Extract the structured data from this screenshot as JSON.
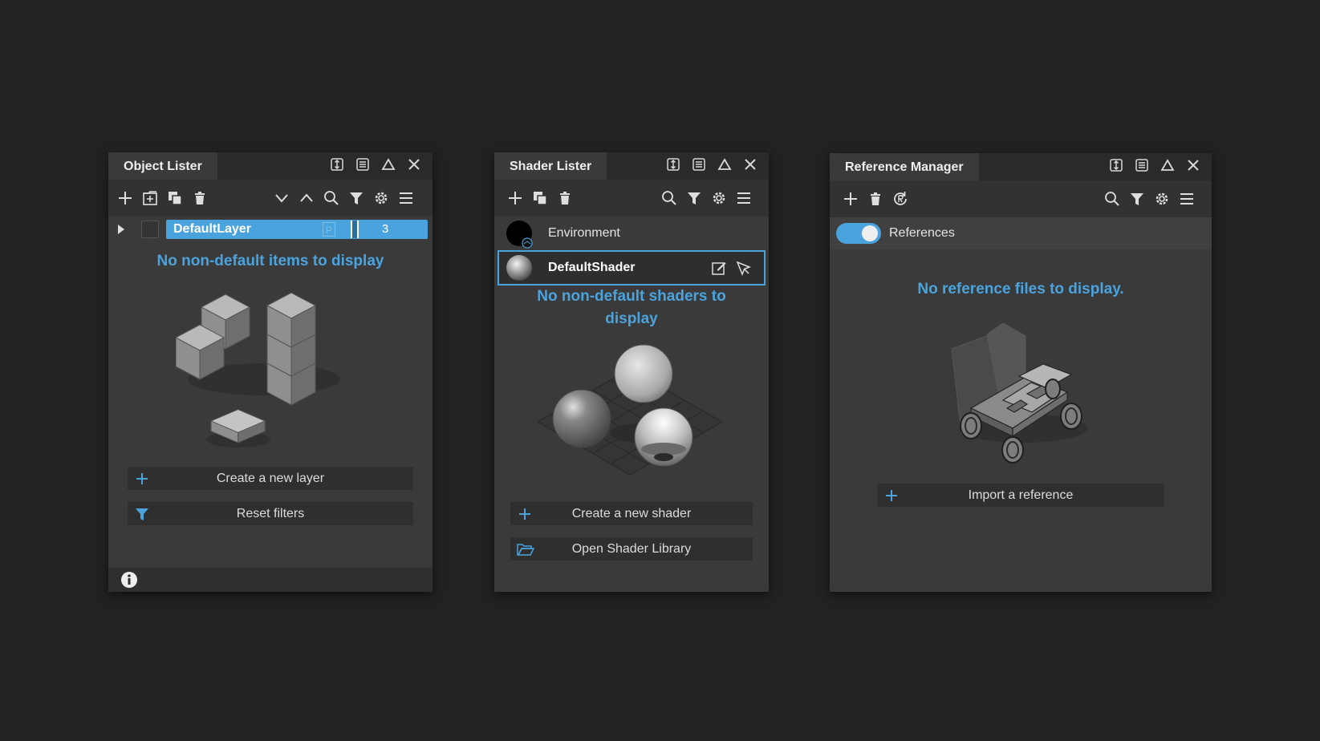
{
  "colors": {
    "accent": "#4ba3dd",
    "panel": "#3a3a3a",
    "background": "#222222"
  },
  "object_lister": {
    "title": "Object Lister",
    "layer": {
      "name": "DefaultLayer",
      "count": "3",
      "p_label": "P"
    },
    "empty_message": "No non-default items to display",
    "actions": {
      "create_layer": "Create a new layer",
      "reset_filters": "Reset filters"
    }
  },
  "shader_lister": {
    "title": "Shader Lister",
    "items": [
      {
        "name": "Environment"
      },
      {
        "name": "DefaultShader"
      }
    ],
    "empty_message": "No non-default shaders to display",
    "actions": {
      "create_shader": "Create a new shader",
      "open_library": "Open Shader Library"
    }
  },
  "reference_manager": {
    "title": "Reference Manager",
    "toggle_label": "References",
    "empty_message": "No reference files to display.",
    "actions": {
      "import_reference": "Import a reference"
    }
  }
}
